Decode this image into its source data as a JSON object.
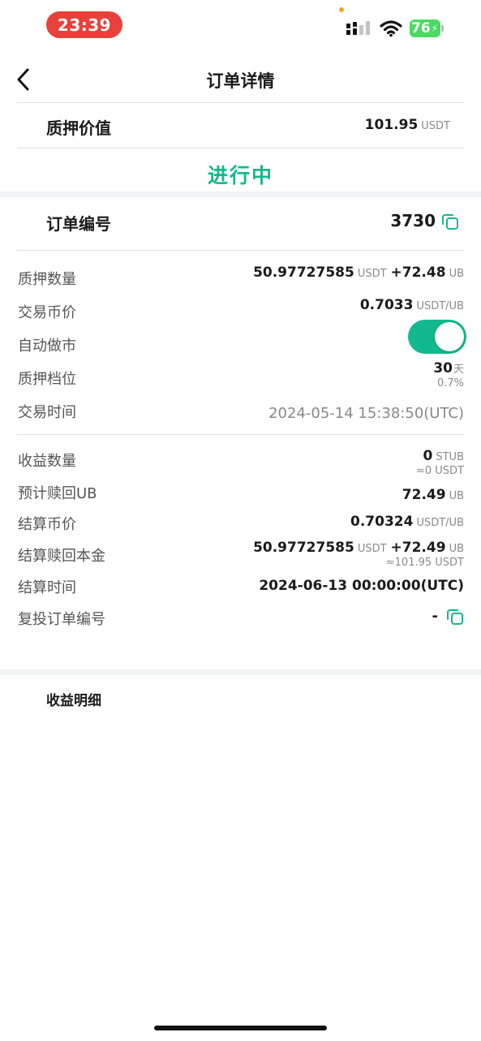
{
  "status_bar": {
    "time": "23:39",
    "battery": "76",
    "colors": {
      "time_pill": "#e8413b",
      "battery": "#4cd964"
    }
  },
  "header": {
    "title": "订单详情",
    "back_icon": "chevron-left-icon"
  },
  "summary": {
    "pledge_value_label": "质押价值",
    "pledge_value": "101.95",
    "pledge_value_unit": "USDT",
    "status": "进行中",
    "status_color": "#13b98e"
  },
  "order": {
    "order_no_label": "订单编号",
    "order_no": "3730",
    "copy_icon": "copy-icon"
  },
  "details": {
    "pledge_qty": {
      "label": "质押数量",
      "value": "50.97727585",
      "unit": "USDT",
      "extra_value": "+72.48",
      "extra_unit": "UB"
    },
    "trade_price": {
      "label": "交易币价",
      "value": "0.7033",
      "unit": "USDT/UB"
    },
    "auto_market": {
      "label": "自动做市",
      "enabled": true
    },
    "pledge_tier": {
      "label": "质押档位",
      "value": "30",
      "unit": "天",
      "rate": "0.7%"
    },
    "trade_time": {
      "label": "交易时间",
      "value": "2024-05-14 15:38:50(UTC)"
    }
  },
  "settlement": {
    "earn_qty": {
      "label": "收益数量",
      "value": "0",
      "unit": "STUB",
      "approx": "≈0 USDT"
    },
    "est_redeem": {
      "label": "预计赎回UB",
      "value": "72.49",
      "unit": "UB"
    },
    "settle_price": {
      "label": "结算币价",
      "value": "0.70324",
      "unit": "USDT/UB"
    },
    "settle_principal": {
      "label": "结算赎回本金",
      "value": "50.97727585",
      "unit": "USDT",
      "extra_value": "+72.49",
      "extra_unit": "UB",
      "approx": "≈101.95 USDT"
    },
    "settle_time": {
      "label": "结算时间",
      "value": "2024-06-13 00:00:00(UTC)"
    },
    "reinvest_no": {
      "label": "复投订单编号",
      "value": "-"
    }
  },
  "earnings": {
    "section_title": "收益明细"
  }
}
